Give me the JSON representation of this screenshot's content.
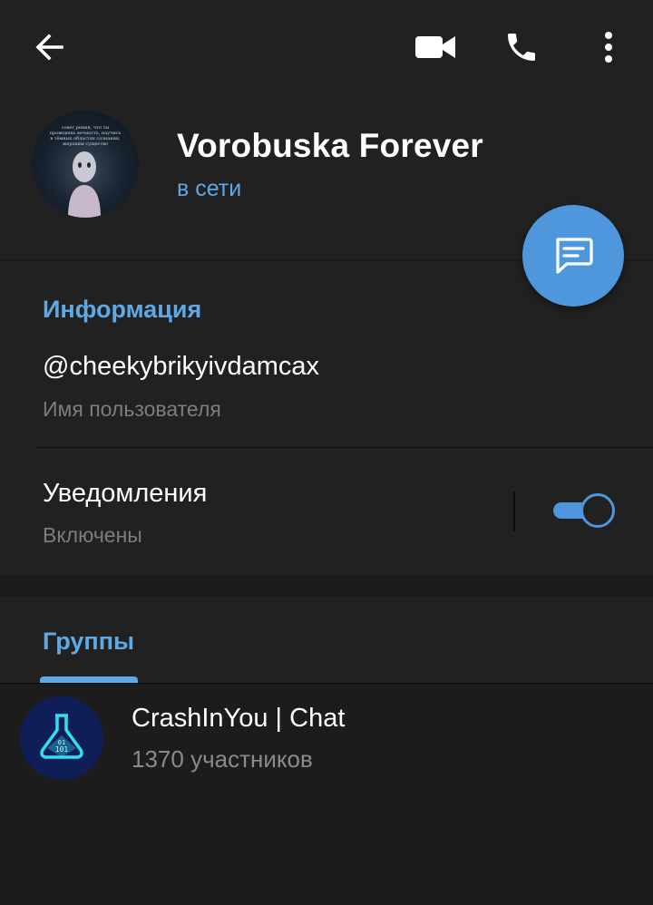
{
  "header": {
    "title": "Vorobuska Forever",
    "status": "в сети",
    "avatar_caption": "совет рения, что ты проведешь вечность, научись в тёмных областях сознания, жерзким существо"
  },
  "icons": {
    "back": "arrow-left-icon",
    "video": "video-camera-icon",
    "call": "phone-icon",
    "more": "more-vertical-icon",
    "message": "message-icon"
  },
  "info": {
    "section_title": "Информация",
    "username": "@cheekybrikyivdamcax",
    "username_label": "Имя пользователя",
    "notifications_label": "Уведомления",
    "notifications_status": "Включены",
    "notifications_enabled": true
  },
  "groups": {
    "tab_label": "Группы",
    "items": [
      {
        "name": "CrashInYou | Chat",
        "members": "1370 участников"
      }
    ]
  },
  "colors": {
    "accent": "#5fa8e6",
    "fab": "#4e97dd",
    "background": "#1c1c1c",
    "surface": "#212121"
  }
}
